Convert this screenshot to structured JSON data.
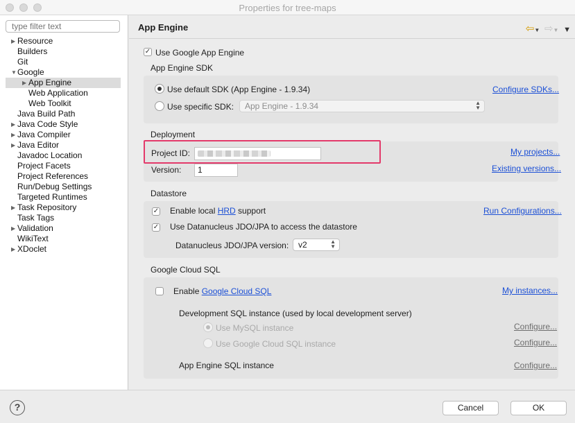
{
  "window": {
    "title": "Properties for tree-maps"
  },
  "sidebar": {
    "filter_placeholder": "type filter text",
    "items": [
      {
        "label": "Resource",
        "twisty": "▶"
      },
      {
        "label": "Builders",
        "twisty": ""
      },
      {
        "label": "Git",
        "twisty": ""
      },
      {
        "label": "Google",
        "twisty": "▼"
      },
      {
        "label": "App Engine",
        "twisty": "▶"
      },
      {
        "label": "Web Application",
        "twisty": ""
      },
      {
        "label": "Web Toolkit",
        "twisty": ""
      },
      {
        "label": "Java Build Path",
        "twisty": ""
      },
      {
        "label": "Java Code Style",
        "twisty": "▶"
      },
      {
        "label": "Java Compiler",
        "twisty": "▶"
      },
      {
        "label": "Java Editor",
        "twisty": "▶"
      },
      {
        "label": "Javadoc Location",
        "twisty": ""
      },
      {
        "label": "Project Facets",
        "twisty": ""
      },
      {
        "label": "Project References",
        "twisty": ""
      },
      {
        "label": "Run/Debug Settings",
        "twisty": ""
      },
      {
        "label": "Targeted Runtimes",
        "twisty": ""
      },
      {
        "label": "Task Repository",
        "twisty": "▶"
      },
      {
        "label": "Task Tags",
        "twisty": ""
      },
      {
        "label": "Validation",
        "twisty": "▶"
      },
      {
        "label": "WikiText",
        "twisty": ""
      },
      {
        "label": "XDoclet",
        "twisty": "▶"
      }
    ],
    "selected": "App Engine"
  },
  "main": {
    "title": "App Engine",
    "use_app_engine": {
      "label": "Use Google App Engine",
      "checked": true
    },
    "sdk": {
      "heading": "App Engine SDK",
      "default_label": "Use default SDK (App Engine - 1.9.34)",
      "specific_label": "Use specific SDK:",
      "specific_value": "App Engine - 1.9.34",
      "configure_link": "Configure SDKs..."
    },
    "deployment": {
      "heading": "Deployment",
      "project_id_label": "Project ID:",
      "version_label": "Version:",
      "version_value": "1",
      "my_projects_link": "My projects...",
      "existing_versions_link": "Existing versions..."
    },
    "datastore": {
      "heading": "Datastore",
      "enable_local_prefix": "Enable local ",
      "hrd_link": "HRD",
      "enable_local_suffix": " support",
      "run_config_link": "Run Configurations...",
      "datanucleus_label": "Use Datanucleus JDO/JPA to access the datastore",
      "datanucleus_version_label": "Datanucleus JDO/JPA version:",
      "datanucleus_version_value": "v2"
    },
    "cloud_sql": {
      "heading": "Google Cloud SQL",
      "enable_prefix": "Enable ",
      "cloud_sql_link": "Google Cloud SQL",
      "my_instances_link": "My instances...",
      "dev_instance_label": "Development SQL instance (used by local development server)",
      "use_mysql_label": "Use MySQL instance",
      "use_cloud_sql_label": "Use Google Cloud SQL instance",
      "configure_link_1": "Configure...",
      "configure_link_2": "Configure...",
      "app_engine_sql_label": "App Engine SQL instance",
      "configure_link_3": "Configure..."
    }
  },
  "footer": {
    "help_glyph": "?",
    "cancel_label": "Cancel",
    "ok_label": "OK"
  },
  "colors": {
    "link": "#1b4fd6",
    "highlight": "#e3396a"
  }
}
